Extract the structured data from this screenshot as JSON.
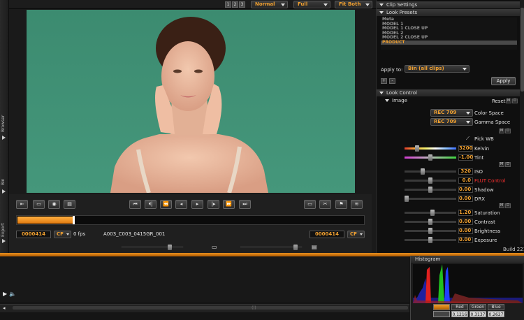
{
  "left_strip": {
    "labels": [
      "Browser",
      "Bin",
      "Export"
    ]
  },
  "topbar": {
    "view_numbers": [
      "1",
      "2",
      "3"
    ],
    "quality": "Normal",
    "resolution": "Full",
    "fit": "Fit Both"
  },
  "transport": {
    "buttons": [
      {
        "name": "first-frame-button",
        "icon": "skip-to-start"
      },
      {
        "name": "prev-mark-button",
        "icon": "previous"
      },
      {
        "name": "rewind-button",
        "icon": "rewind"
      },
      {
        "name": "step-back-button",
        "icon": "step-back"
      },
      {
        "name": "play-button",
        "icon": "play"
      },
      {
        "name": "step-forward-button",
        "icon": "step-forward"
      },
      {
        "name": "fast-forward-button",
        "icon": "fast-forward"
      },
      {
        "name": "last-frame-button",
        "icon": "skip-to-end"
      }
    ],
    "progress_fraction": 0.16,
    "timecode_in": "0000414",
    "in_mode": "CF",
    "fps": "0 fps",
    "clip_name": "A003_C003_0415GR_001",
    "timecode_out": "0000414",
    "out_mode": "CF"
  },
  "clip_settings": {
    "title": "Clip Settings",
    "look_presets": {
      "title": "Look Presets",
      "items": [
        "Meta",
        "MODEL 1",
        "MODEL 1 CLOSE UP",
        "MODEL 2",
        "MODEL 2 CLOSE UP",
        "PRODUCT"
      ],
      "selected_index": 5,
      "apply_to_label": "Apply to:",
      "apply_to_value": "Bin (all clips)",
      "add": "+",
      "remove": "-",
      "apply": "Apply"
    },
    "look_control": {
      "title": "Look Control",
      "image_title": "Image",
      "reset": "Reset",
      "md": [
        "M",
        "D"
      ],
      "color_space_value": "REC 709",
      "color_space_label": "Color Space",
      "gamma_space_value": "REC 709",
      "gamma_space_label": "Gamma Space",
      "pick_wb": "Pick WB",
      "controls": [
        {
          "label": "Kelvin",
          "value": "3200",
          "fraction": 0.22
        },
        {
          "label": "Tint",
          "value": "-1.00",
          "fraction": 0.5
        },
        {
          "label": "ISO",
          "value": "320",
          "fraction": 0.34
        },
        {
          "label": "FLUT Control",
          "value": "0.0",
          "fraction": 0.5
        },
        {
          "label": "Shadow",
          "value": "0.00",
          "fraction": 0.5
        },
        {
          "label": "DRX",
          "value": "0.00",
          "fraction": 0.0
        },
        {
          "label": "Saturation",
          "value": "1.20",
          "fraction": 0.55
        },
        {
          "label": "Contrast",
          "value": "0.00",
          "fraction": 0.5
        },
        {
          "label": "Brightness",
          "value": "0.00",
          "fraction": 0.5
        },
        {
          "label": "Exposure",
          "value": "0.00",
          "fraction": 0.5
        }
      ]
    },
    "build": "Build 221"
  },
  "histogram": {
    "title": "Histogram",
    "channels": [
      "Red",
      "Green",
      "Blue"
    ],
    "values": [
      "0.1216",
      "0.3137",
      "0.2627"
    ]
  },
  "colors": {
    "accent": "#f0a030",
    "background": "#1a1a1a",
    "green_screen": "#3f8f73"
  }
}
